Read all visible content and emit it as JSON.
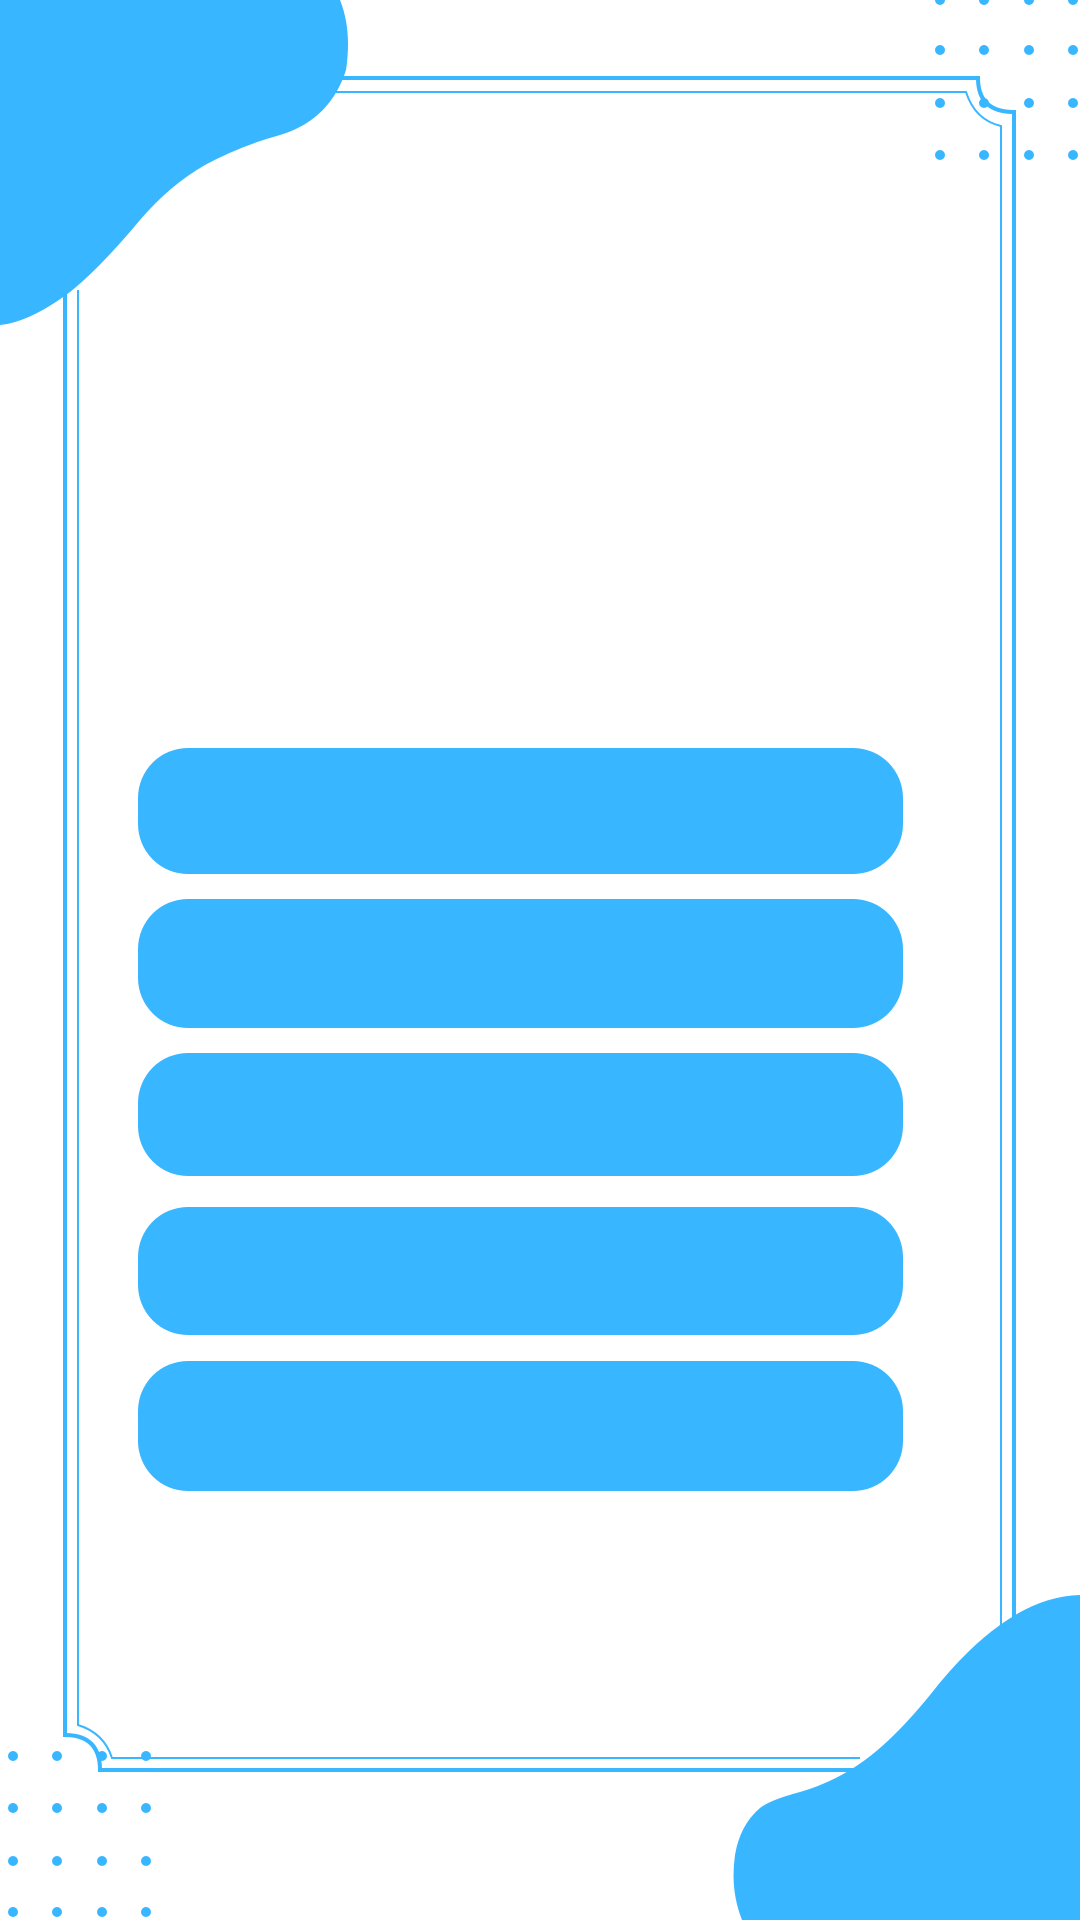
{
  "theme": {
    "accent": "#38b6ff",
    "background": "#ffffff"
  },
  "menu": {
    "buttons": [
      {
        "id": "menu-button-1",
        "label": ""
      },
      {
        "id": "menu-button-2",
        "label": ""
      },
      {
        "id": "menu-button-3",
        "label": ""
      },
      {
        "id": "menu-button-4",
        "label": ""
      },
      {
        "id": "menu-button-5",
        "label": ""
      }
    ]
  }
}
